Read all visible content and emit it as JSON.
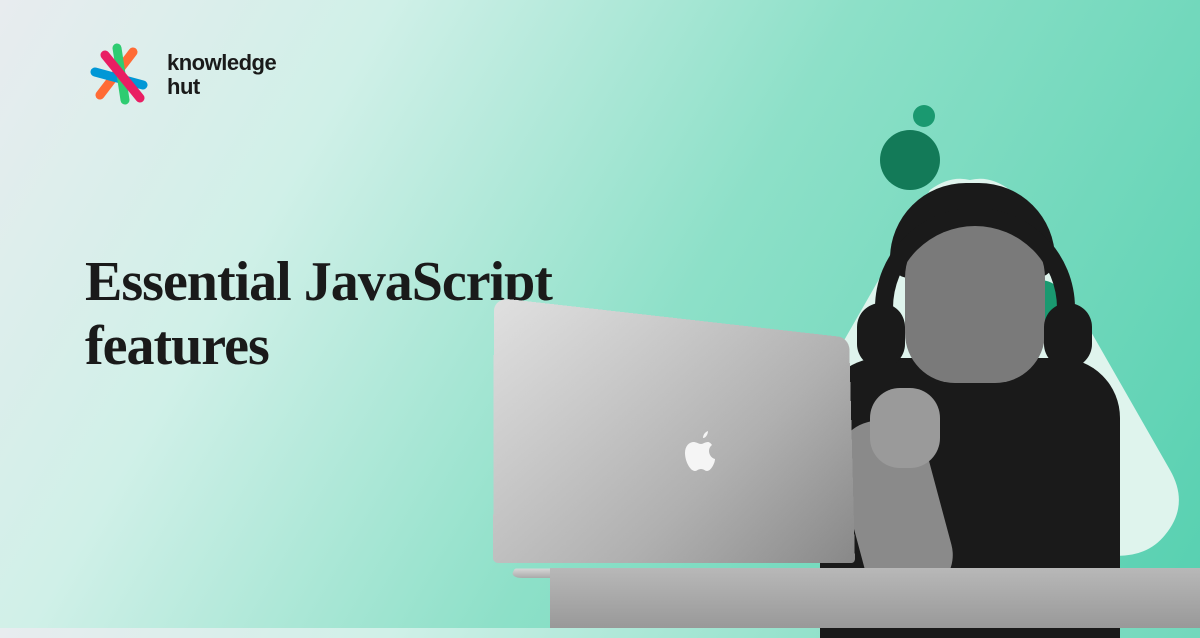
{
  "brand": {
    "name_line1": "knowledge",
    "name_line2": "hut"
  },
  "headline": {
    "line1": "Essential JavaScript",
    "line2": "features"
  },
  "colors": {
    "accent": "#1a9970",
    "text": "#1a1a1a"
  }
}
